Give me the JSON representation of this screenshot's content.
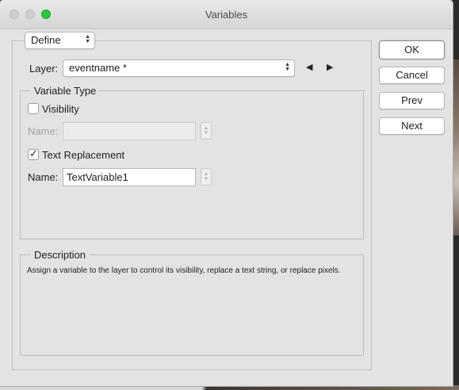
{
  "window": {
    "title": "Variables"
  },
  "define_menu": {
    "value": "Define"
  },
  "layer": {
    "label": "Layer:",
    "value": "eventname *",
    "prev_icon": "◀",
    "next_icon": "▶"
  },
  "variable_type": {
    "title": "Variable Type",
    "visibility": {
      "label": "Visibility",
      "checked": false,
      "name_label": "Name:",
      "name_value": ""
    },
    "text_replacement": {
      "label": "Text Replacement",
      "checked": true,
      "name_label": "Name:",
      "name_value": "TextVariable1"
    }
  },
  "description": {
    "title": "Description",
    "text": "Assign a variable to the layer to control its visibility, replace a text string, or replace pixels."
  },
  "buttons": {
    "ok": "OK",
    "cancel": "Cancel",
    "prev": "Prev",
    "next": "Next"
  },
  "colors": {
    "zoom_button": "#2ac840",
    "window_bg": "#e3e3e3"
  }
}
